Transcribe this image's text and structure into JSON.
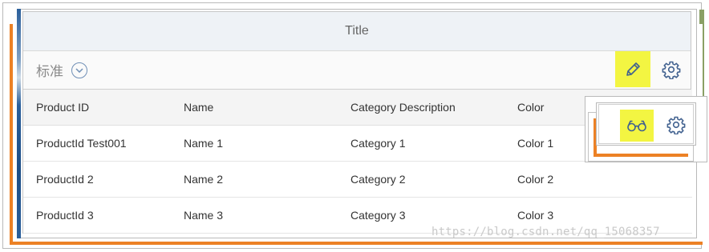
{
  "panel": {
    "title": "Title"
  },
  "toolbar": {
    "variant_label": "标准"
  },
  "table": {
    "headers": [
      "Product ID",
      "Name",
      "Category Description",
      "Color"
    ],
    "rows": [
      [
        "ProductId Test001",
        "Name 1",
        "Category 1",
        "Color 1"
      ],
      [
        "ProductId 2",
        "Name 2",
        "Category 2",
        "Color 2"
      ],
      [
        "ProductId 3",
        "Name 3",
        "Category 3",
        "Color 3"
      ]
    ]
  },
  "icons": {
    "variant": "chevron-down-circle-icon",
    "edit": "pencil-icon",
    "settings": "gear-icon",
    "display": "glasses-icon"
  },
  "colors": {
    "highlight": "#f3f542",
    "frame_orange": "#ec8125",
    "frame_green": "#8aa065",
    "frame_blue": "#2b5f9b",
    "icon_blue": "#41618f"
  },
  "watermark": "https://blog.csdn.net/qq_15068357"
}
